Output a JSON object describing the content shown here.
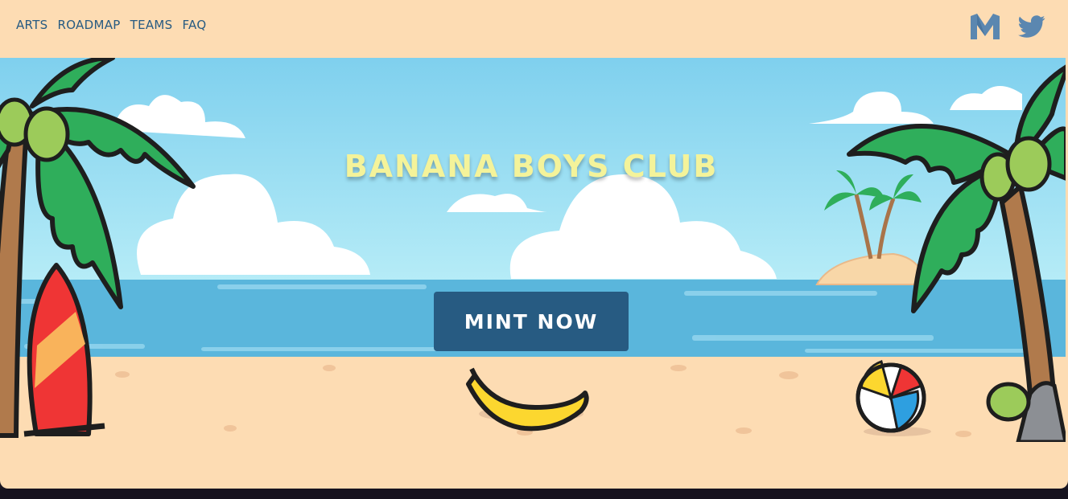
{
  "nav": {
    "links": [
      {
        "label": "ARTS"
      },
      {
        "label": "ROADMAP"
      },
      {
        "label": "TEAMS"
      },
      {
        "label": "FAQ"
      }
    ]
  },
  "socials": {
    "icons": [
      "marketplace-m-icon",
      "twitter-bird-icon"
    ]
  },
  "hero": {
    "title": "BANANA BOYS CLUB",
    "cta_label": "MINT NOW"
  },
  "colors": {
    "nav_text": "#275b82",
    "social_icon": "#5b87b0",
    "button_bg": "#275b82",
    "button_text": "#ffffff",
    "title": "#f4f39a",
    "sand": "#fddcb3",
    "sky": "#8dd6ef",
    "sea": "#5ab6dc"
  }
}
